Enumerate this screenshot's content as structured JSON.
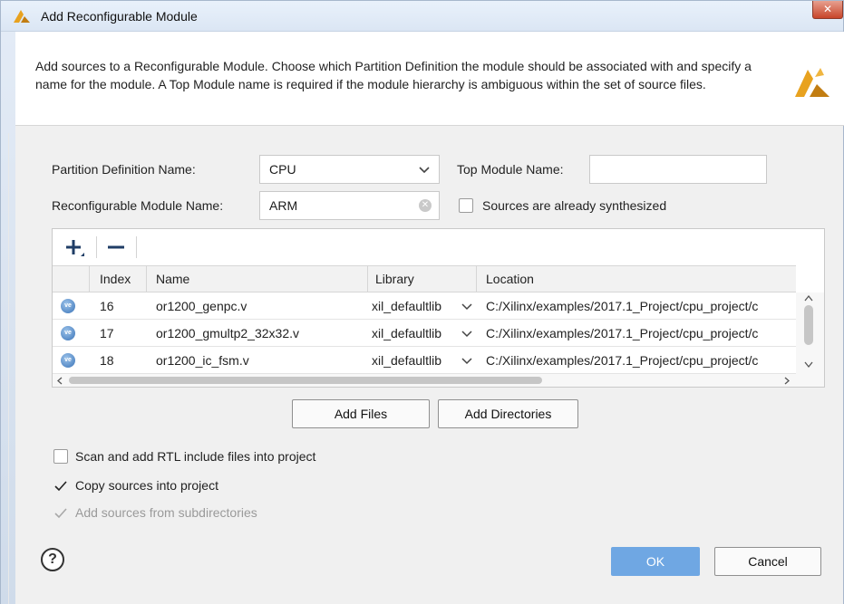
{
  "window": {
    "title": "Add Reconfigurable Module",
    "close_glyph": "✕"
  },
  "header": {
    "description": "Add sources to a Reconfigurable Module. Choose which Partition Definition the module should be associated with and specify a name for the module. A Top Module name is required if the module hierarchy is ambiguous within the set of source files."
  },
  "form": {
    "partition_label": "Partition Definition Name:",
    "partition_value": "CPU",
    "top_module_label": "Top Module Name:",
    "top_module_value": "",
    "rm_name_label": "Reconfigurable Module Name:",
    "rm_name_value": "ARM",
    "sources_synth_label": "Sources are already synthesized",
    "sources_synth_checked": false
  },
  "table": {
    "columns": [
      "Index",
      "Name",
      "Library",
      "Location"
    ],
    "rows": [
      {
        "icon": "ve",
        "index": "16",
        "name": "or1200_genpc.v",
        "library": "xil_defaultlib",
        "location": "C:/Xilinx/examples/2017.1_Project/cpu_project/c"
      },
      {
        "icon": "ve",
        "index": "17",
        "name": "or1200_gmultp2_32x32.v",
        "library": "xil_defaultlib",
        "location": "C:/Xilinx/examples/2017.1_Project/cpu_project/c"
      },
      {
        "icon": "ve",
        "index": "18",
        "name": "or1200_ic_fsm.v",
        "library": "xil_defaultlib",
        "location": "C:/Xilinx/examples/2017.1_Project/cpu_project/c"
      }
    ]
  },
  "buttons": {
    "add_files": "Add Files",
    "add_directories": "Add Directories",
    "ok": "OK",
    "cancel": "Cancel",
    "help": "?"
  },
  "options": {
    "scan_rtl_label": "Scan and add RTL include files into project",
    "scan_rtl_checked": false,
    "copy_sources_label": "Copy sources into project",
    "copy_sources_checked": true,
    "add_subdirs_label": "Add sources from subdirectories",
    "add_subdirs_checked": true,
    "add_subdirs_enabled": false
  },
  "colors": {
    "primary_button": "#6fa7e3",
    "title_bar": "#dbe6f4",
    "close_button": "#c8452a"
  }
}
